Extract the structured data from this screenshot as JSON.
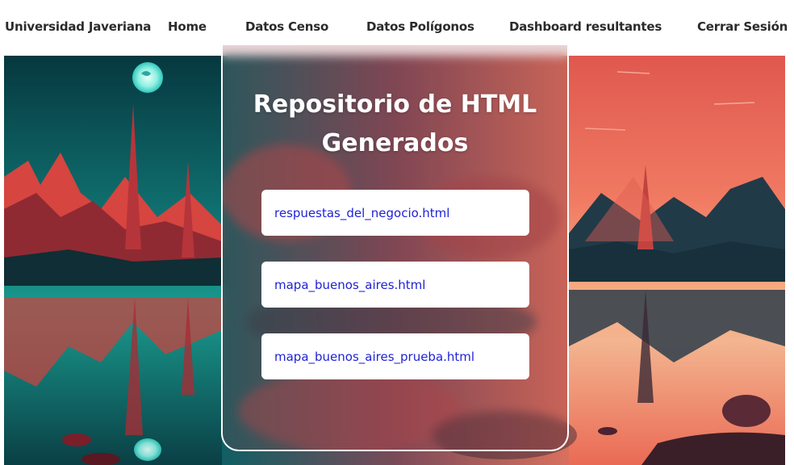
{
  "nav": {
    "brand": "Universidad Javeriana",
    "home": "Home",
    "datos_censo": "Datos Censo",
    "datos_poligonos": "Datos Polígonos",
    "dashboard": "Dashboard resultantes",
    "logout": "Cerrar Sesión"
  },
  "panel": {
    "title_line1": "Repositorio de HTML",
    "title_line2": "Generados"
  },
  "files": [
    "respuestas_del_negocio.html",
    "mapa_buenos_aires.html",
    "mapa_buenos_aires_prueba.html"
  ],
  "colors": {
    "link": "#1f23d6",
    "teal": "#127a78",
    "coral": "#f07a62"
  }
}
